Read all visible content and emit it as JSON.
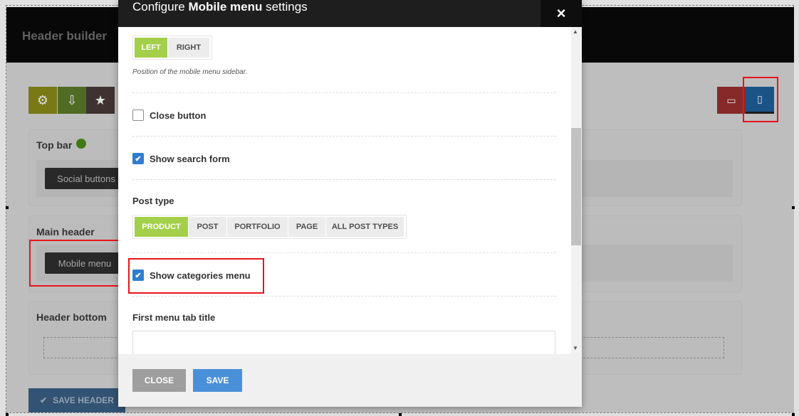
{
  "background": {
    "title": "Header builder",
    "toolbar": {
      "left_icons": [
        "gear-icon",
        "download-icon",
        "star-icon"
      ],
      "right_icons": [
        "desktop-icon",
        "mobile-icon"
      ]
    },
    "panels": {
      "top_bar": {
        "title": "Top bar",
        "chip": "Social buttons"
      },
      "main_header": {
        "title": "Main header",
        "chip": "Mobile menu"
      },
      "header_bottom": {
        "title": "Header bottom"
      }
    },
    "save_header_label": "SAVE HEADER",
    "colors": {
      "gear": "#8a8a1a",
      "download": "#5a7a2a",
      "star": "#4a3a3a",
      "desktop": "#9a2f2f",
      "mobile": "#1f5f9a"
    }
  },
  "modal": {
    "title_prefix": "Configure",
    "title_bold": "Mobile menu",
    "title_suffix": "settings",
    "close_icon": "×",
    "position": {
      "options": [
        "LEFT",
        "RIGHT"
      ],
      "selected": "LEFT",
      "hint": "Position of the mobile menu sidebar."
    },
    "close_button": {
      "label": "Close button",
      "checked": false
    },
    "show_search_form": {
      "label": "Show search form",
      "checked": true
    },
    "post_type": {
      "label": "Post type",
      "options": [
        "PRODUCT",
        "POST",
        "PORTFOLIO",
        "PAGE",
        "ALL POST TYPES"
      ],
      "selected": "PRODUCT"
    },
    "show_categories_menu": {
      "label": "Show categories menu",
      "checked": true
    },
    "first_menu_tab_title": {
      "label": "First menu tab title",
      "value": ""
    },
    "footer": {
      "close_label": "CLOSE",
      "save_label": "SAVE"
    },
    "colors": {
      "accent_green": "#a4cf4a",
      "save_blue": "#4a90d9",
      "close_gray": "#9e9e9e",
      "checkbox_blue": "#2e7dd1"
    }
  },
  "annotations": {
    "highlight_color": "#e8141c"
  }
}
